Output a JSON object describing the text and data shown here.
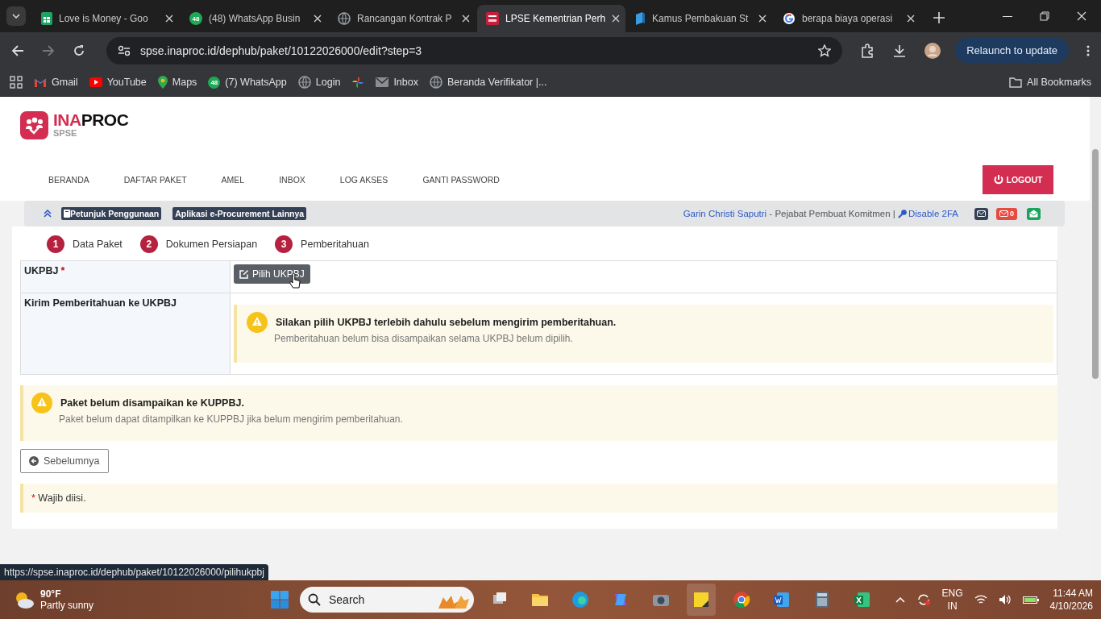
{
  "browser": {
    "tabs": [
      {
        "title": "Love is Money - Goo",
        "kind": "sheets",
        "selected": false
      },
      {
        "title": "(48) WhatsApp Busin",
        "kind": "whatsapp",
        "badge": "48",
        "selected": false
      },
      {
        "title": "Rancangan Kontrak P",
        "kind": "globe",
        "selected": false
      },
      {
        "title": "LPSE Kementrian Perh",
        "kind": "lpse",
        "selected": true
      },
      {
        "title": "Kamus Pembakuan St",
        "kind": "kamus",
        "selected": false
      },
      {
        "title": "berapa biaya operasi",
        "kind": "google",
        "selected": false
      }
    ],
    "url": "spse.inaproc.id/dephub/paket/10122026000/edit?step=3",
    "relaunch": "Relaunch to update",
    "bookmarks": [
      {
        "label": "Gmail",
        "kind": "gmail"
      },
      {
        "label": "YouTube",
        "kind": "youtube"
      },
      {
        "label": "Maps",
        "kind": "maps"
      },
      {
        "label": "(7) WhatsApp",
        "kind": "whatsapp",
        "badge": "48"
      },
      {
        "label": "Login",
        "kind": "globe"
      },
      {
        "kind": "pinwheel"
      },
      {
        "label": "Inbox",
        "kind": "mail"
      },
      {
        "label": "Beranda Verifikator |...",
        "kind": "globe"
      }
    ],
    "all_bookmarks": "All Bookmarks"
  },
  "page": {
    "logo": {
      "brand_a": "INA",
      "brand_b": "PROC",
      "sub": "SPSE"
    },
    "nav": [
      "BERANDA",
      "DAFTAR PAKET",
      "AMEL",
      "INBOX",
      "LOG AKSES",
      "GANTI PASSWORD"
    ],
    "logout": "LOGOUT",
    "toolbar": {
      "links": [
        "Petunjuk Penggunaan",
        "Aplikasi e-Procurement Lainnya"
      ],
      "user": "Garin Christi Saputri",
      "role": " - Pejabat Pembuat Komitmen | ",
      "disable_2fa": "Disable 2FA",
      "unread": "0"
    },
    "steps": [
      {
        "number": "1",
        "label": "Data Paket"
      },
      {
        "number": "2",
        "label": "Dokumen Persiapan"
      },
      {
        "number": "3",
        "label": "Pemberitahuan"
      }
    ],
    "form": [
      {
        "label": "UKPBJ",
        "required": true,
        "kind": "button",
        "button": "Pilih UKPBJ"
      },
      {
        "label": "Kirim Pemberitahuan ke UKPBJ",
        "required": false,
        "kind": "alert",
        "title": "Silakan pilih UKPBJ terlebih dahulu sebelum mengirim pemberitahuan.",
        "text": "Pemberitahuan belum bisa disampaikan selama UKPBJ belum dipilih."
      }
    ],
    "alert": {
      "title": "Paket belum disampaikan ke KUPPBJ.",
      "text": "Paket belum dapat ditampilkan ke KUPPBJ jika belum mengirim pemberitahuan."
    },
    "back": "Sebelumnya",
    "note": {
      "mark": "*",
      "text": " Wajib diisi."
    },
    "status_url": "https://spse.inaproc.id/dephub/paket/10122026000/pilihukpbj"
  },
  "taskbar": {
    "temp": "90°F",
    "weather": "Partly sunny",
    "search": "Search",
    "lang": "ENG",
    "region": "IN",
    "time": "11:44 AM",
    "date": "4/10/2026"
  }
}
